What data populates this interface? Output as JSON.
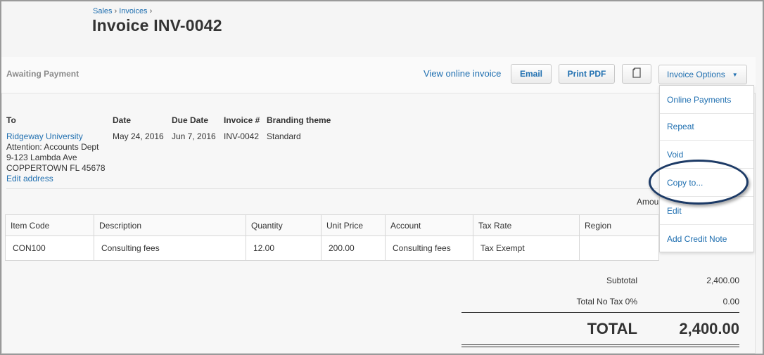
{
  "breadcrumb": {
    "items": [
      "Sales",
      "Invoices"
    ]
  },
  "title": "Invoice INV-0042",
  "status": "Awaiting Payment",
  "actions": {
    "view_online": "View online invoice",
    "email": "Email",
    "print_pdf": "Print PDF",
    "copy_icon": "document-icon",
    "options": "Invoice Options",
    "options_caret": "▼"
  },
  "options_menu": [
    "Online Payments",
    "Repeat",
    "Void",
    "Copy to...",
    "Edit",
    "Add Credit Note"
  ],
  "details": {
    "to_label": "To",
    "date_label": "Date",
    "due_label": "Due Date",
    "invoice_label": "Invoice #",
    "branding_label": "Branding theme",
    "customer": "Ridgeway University",
    "attention": "Attention: Accounts Dept",
    "address1": "9-123 Lambda Ave",
    "address2": "COPPERTOWN FL 45678",
    "edit_address": "Edit address",
    "date": "May 24, 2016",
    "due_date": "Jun 7, 2016",
    "invoice_no": "INV-0042",
    "branding": "Standard"
  },
  "amount_header_partial": "Amou",
  "table": {
    "headers": [
      "Item Code",
      "Description",
      "Quantity",
      "Unit Price",
      "Account",
      "Tax Rate",
      "Region"
    ],
    "rows": [
      [
        "CON100",
        "Consulting fees",
        "12.00",
        "200.00",
        "Consulting fees",
        "Tax Exempt",
        ""
      ]
    ]
  },
  "totals": {
    "subtotal_label": "Subtotal",
    "subtotal": "2,400.00",
    "tax_label": "Total No Tax 0%",
    "tax": "0.00",
    "total_label": "TOTAL",
    "total": "2,400.00"
  },
  "colors": {
    "link": "#1f6fb0",
    "callout": "#1c3a66"
  }
}
